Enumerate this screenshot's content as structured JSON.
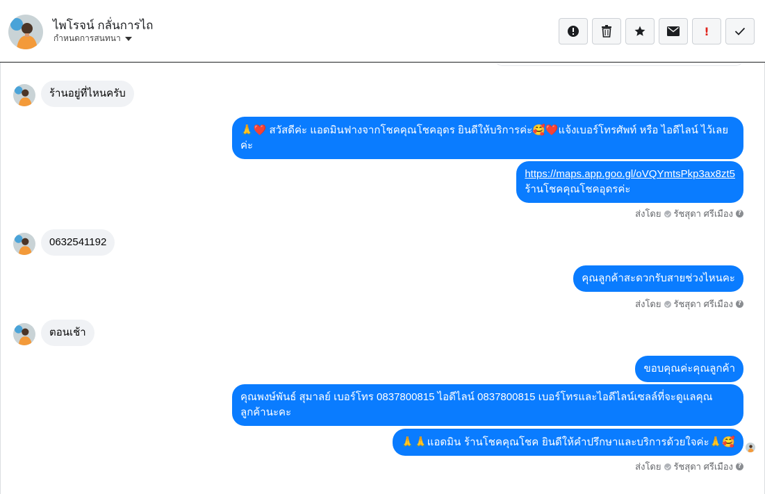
{
  "header": {
    "contact_name": "ไพโรจน์ กลั่นการไถ",
    "conversation_settings": "กำหนดการสนทนา",
    "actions": [
      {
        "name": "report-button",
        "icon": "alert-circle-icon"
      },
      {
        "name": "delete-button",
        "icon": "trash-icon"
      },
      {
        "name": "star-button",
        "icon": "star-icon"
      },
      {
        "name": "mark-unread-button",
        "icon": "envelope-icon"
      },
      {
        "name": "mark-important-button",
        "icon": "exclamation-icon"
      },
      {
        "name": "done-button",
        "icon": "check-icon"
      }
    ]
  },
  "messages": {
    "m1": "ร้านอยู่ที่ไหนครับ",
    "m2_prefix": "🙏❤️",
    "m2_text": " สวัสดีค่ะ แอดมินฟางจากโชคคุณโชคอุดร ยินดีให้บริการค่ะ🥰❤️แจ้งเบอร์โทรศัพท์ หรือ ไอดีไลน์  ไว้เลยค่ะ",
    "m3_link": "https://maps.app.goo.gl/oVQYmtsPkp3ax8zt5",
    "m3_text": "ร้านโชคคุณโชคอุดรค่ะ",
    "m4": "0632541192",
    "m5": "คุณลูกค้าสะดวกรับสายช่วงไหนคะ",
    "m6": "ตอนเช้า",
    "m7": "ขอบคุณค่ะคุณลูกค้า",
    "m8": "คุณพงษ์พันธ์ สุมาลย์      เบอร์โทร 0837800815  ไอดีไลน์ 0837800815   เบอร์โทรและไอดีไลน์เซลล์ที่จะดูแลคุณลูกค้านะคะ",
    "m9": "🙏🙏แอดมิน ร้านโชคคุณโชค ยินดีให้คำปรึกษาและบริการด้วยใจค่ะ🙏🥰"
  },
  "sent_by": {
    "label": "ส่งโดย",
    "agent": "รัชสุดา ศรีเมือง",
    "help": "?"
  },
  "colors": {
    "outgoing_bubble": "#0a7cff",
    "incoming_bubble": "#f0f2f5",
    "meta_text": "#65676b"
  }
}
